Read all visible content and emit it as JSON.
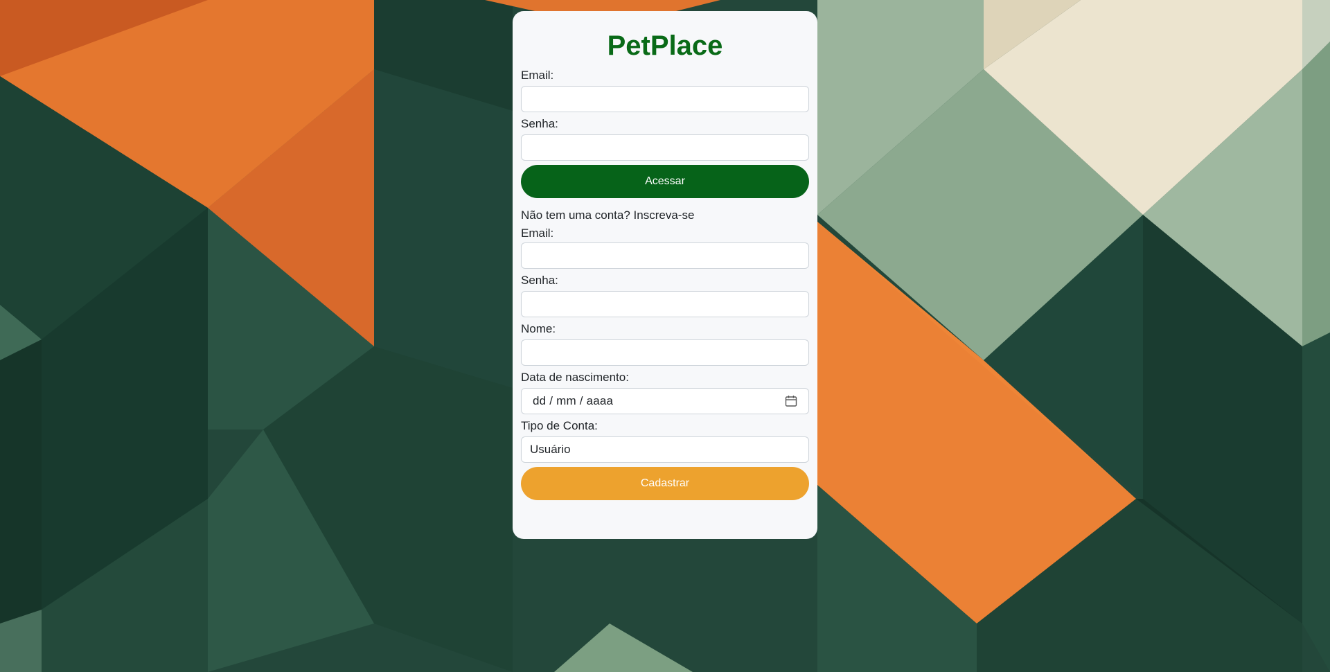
{
  "app": {
    "title": "PetPlace",
    "brand_color": "#096a17"
  },
  "login": {
    "email_label": "Email:",
    "email_value": "",
    "password_label": "Senha:",
    "password_value": "",
    "submit_label": "Acessar",
    "submit_color": "#066319"
  },
  "signup": {
    "prompt": "Não tem uma conta? Inscreva-se",
    "email_label": "Email:",
    "email_value": "",
    "password_label": "Senha:",
    "password_value": "",
    "name_label": "Nome:",
    "name_value": "",
    "birthdate_label": "Data de nascimento:",
    "birthdate_placeholder": "dd / mm / aaaa",
    "account_type_label": "Tipo de Conta:",
    "account_type_value": "Usuário",
    "submit_label": "Cadastrar",
    "submit_color": "#eda22e"
  },
  "icons": {
    "date_picker": "calendar-icon"
  },
  "background": {
    "pattern": "geometric-triangles",
    "colors": [
      "#e8782e",
      "#23473a",
      "#16352a",
      "#8fae93",
      "#ede5d0"
    ]
  }
}
